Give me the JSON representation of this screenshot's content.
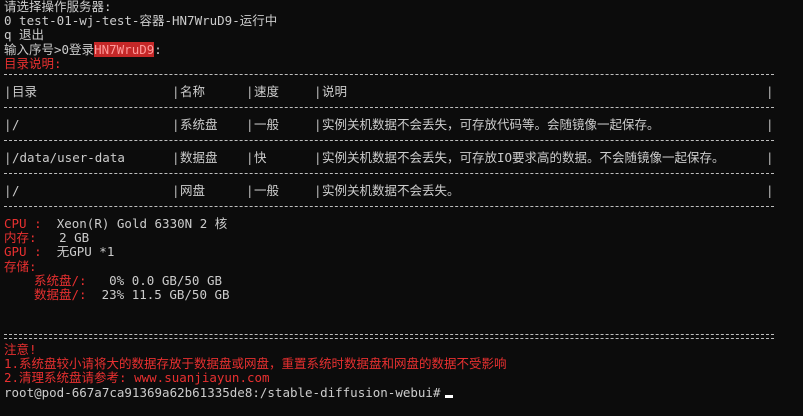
{
  "prompt": {
    "title": "请选择操作服务器:",
    "servers": [
      "0 test-01-wj-test-容器-HN7WruD9-运行中"
    ],
    "exit_option": "q 退出",
    "input_prefix": "输入序号>0登录",
    "input_highlight": "HN7WruD9",
    "input_suffix": ":"
  },
  "directory": {
    "title": "目录说明:",
    "headers": [
      "目录",
      "名称",
      "速度",
      "说明"
    ],
    "rows": [
      [
        "/",
        "系统盘",
        "一般",
        "实例关机数据不会丢失，可存放代码等。会随镜像一起保存。"
      ],
      [
        "/data/user-data",
        "数据盘",
        "快",
        "实例关机数据不会丢失，可存放IO要求高的数据。不会随镜像一起保存。"
      ],
      [
        "/",
        "网盘",
        "一般",
        "实例关机数据不会丢失。"
      ]
    ]
  },
  "specs": {
    "cpu_label": "CPU :",
    "cpu_value": "Xeon(R) Gold 6330N 2 核",
    "mem_label": "内存:",
    "mem_value": "2 GB",
    "gpu_label": "GPU :",
    "gpu_value": "无GPU *1",
    "storage_label": "存储:",
    "sys_disk_label": "系统盘/:",
    "sys_disk_value": "0% 0.0 GB/50 GB",
    "data_disk_label": "数据盘/:",
    "data_disk_value": "23% 11.5 GB/50 GB"
  },
  "notice": {
    "title": "注意!",
    "line1": "1.系统盘较小请将大的数据存放于数据盘或网盘，重置系统时数据盘和网盘的数据不受影响",
    "line2": "2.清理系统盘请参考: www.suanjiayun.com"
  },
  "shell": {
    "prompt": "root@pod-667a7ca91369a62b61335de8:/stable-diffusion-webui#"
  },
  "colors": {
    "background": "#0c0c0c",
    "text": "#cccccc",
    "red": "#e83030",
    "highlight": "#c52828"
  }
}
